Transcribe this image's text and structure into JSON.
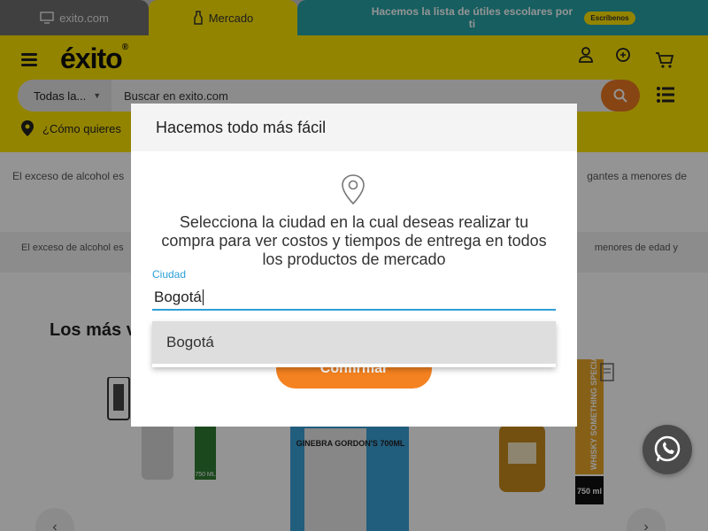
{
  "tabs": {
    "exito_label": "exito.com",
    "mercado_label": "Mercado",
    "promo_text": "Hacemos la lista de útiles escolares por ti",
    "promo_badge": "Escríbenos"
  },
  "header": {
    "logo_text": "éxito",
    "search": {
      "category": "Todas la...",
      "placeholder": "Buscar en exito.com"
    },
    "location_text": "¿Cómo quieres"
  },
  "page": {
    "notice1_left": "El exceso de alcohol es",
    "notice1_right": "gantes a menores de",
    "notice2_left": "El exceso de alcohol es",
    "notice2_right": "menores de edad y",
    "section_title": "Los más v",
    "product_labels": [
      "750 ML",
      "750 ml",
      "WHISKY SOMETHING SPECIAL",
      "GINEBRA GORDON'S 700ML"
    ]
  },
  "modal": {
    "title": "Hacemos todo más fácil",
    "message": "Selecciona la ciudad en la cual deseas realizar tu compra para ver costos y tiempos de entrega en todos los productos de mercado",
    "city_label": "Ciudad",
    "city_value": "Bogotá",
    "confirm_label": "Confirmar",
    "suggestions": [
      "Bogotá"
    ]
  },
  "colors": {
    "brand_yellow": "#fde300",
    "accent_orange": "#f58220",
    "promo_teal": "#27a2a6",
    "field_blue": "#2b9fd9"
  }
}
